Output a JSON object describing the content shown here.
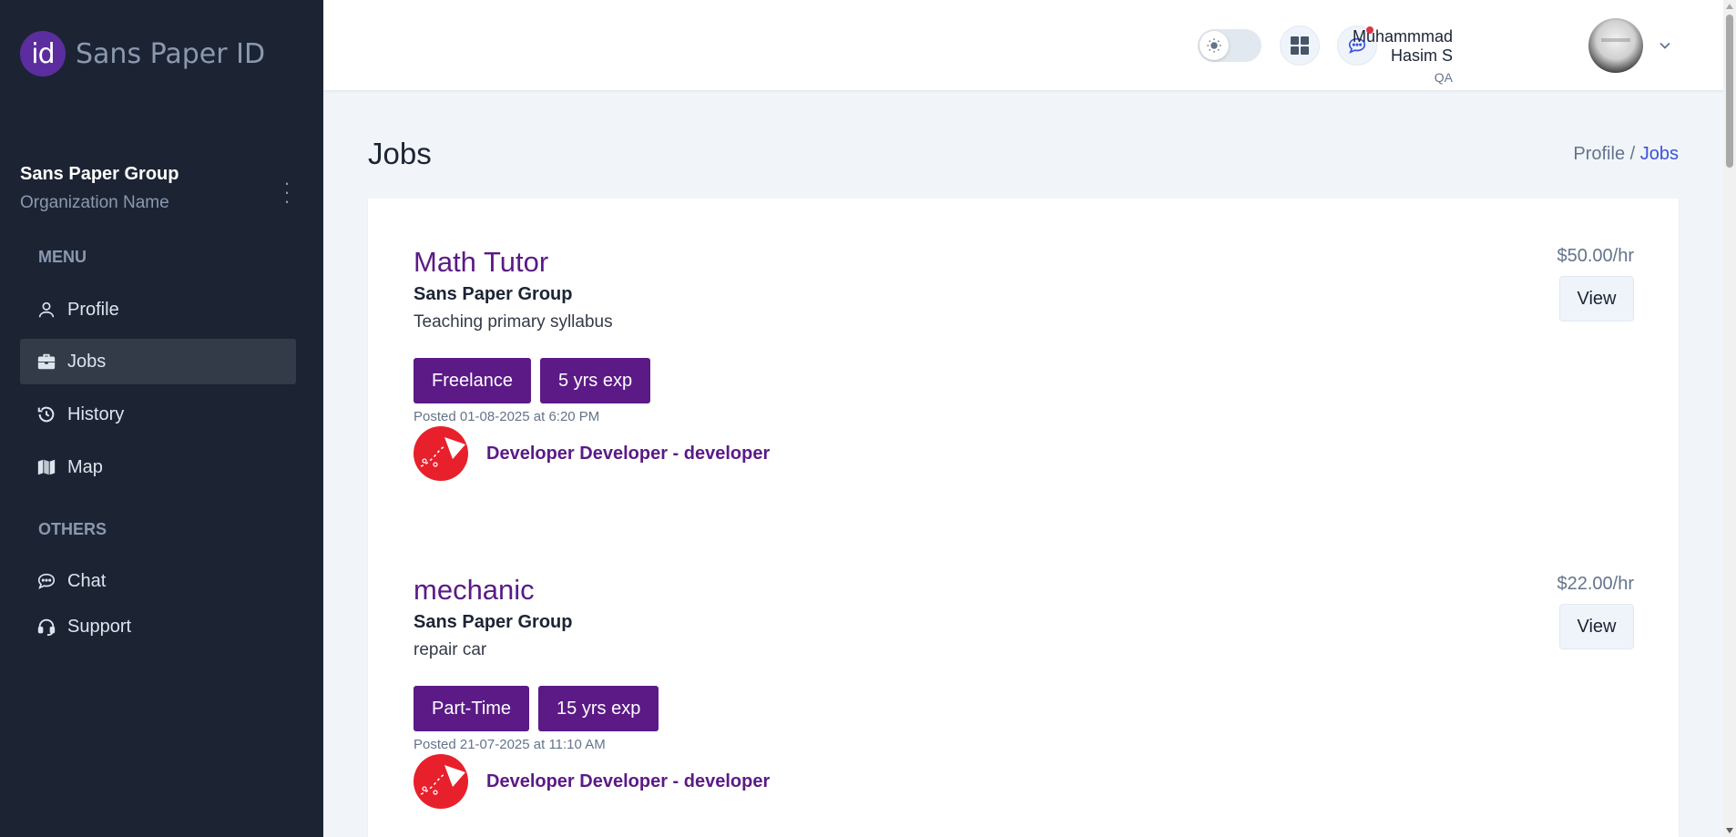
{
  "brand": {
    "logo_text": "id",
    "name": "Sans Paper ID"
  },
  "organization": {
    "name": "Sans Paper Group",
    "subtitle": "Organization Name"
  },
  "sidebar": {
    "menu_title": "MENU",
    "menu_items": [
      {
        "label": "Profile",
        "icon": "user-icon",
        "active": false
      },
      {
        "label": "Jobs",
        "icon": "briefcase-icon",
        "active": true
      },
      {
        "label": "History",
        "icon": "history-icon",
        "active": false
      },
      {
        "label": "Map",
        "icon": "map-icon",
        "active": false
      }
    ],
    "others_title": "OTHERS",
    "others_items": [
      {
        "label": "Chat",
        "icon": "chat-icon"
      },
      {
        "label": "Support",
        "icon": "headset-icon"
      }
    ]
  },
  "header": {
    "user_name": "Muhammmad Hasim S",
    "user_role": "QA",
    "has_notification": true
  },
  "page": {
    "title": "Jobs",
    "breadcrumb": {
      "parent": "Profile /",
      "current": "Jobs"
    }
  },
  "jobs": [
    {
      "title": "Math Tutor",
      "organization": "Sans Paper Group",
      "description": "Teaching primary syllabus",
      "tags": [
        "Freelance",
        "5 yrs exp"
      ],
      "posted": "Posted 01-08-2025 at 6:20 PM",
      "poster": "Developer Developer - developer",
      "rate": "$50.00/hr",
      "view_label": "View"
    },
    {
      "title": "mechanic",
      "organization": "Sans Paper Group",
      "description": "repair car",
      "tags": [
        "Part-Time",
        "15 yrs exp"
      ],
      "posted": "Posted 21-07-2025 at 11:10 AM",
      "poster": "Developer Developer - developer",
      "rate": "$22.00/hr",
      "view_label": "View"
    }
  ],
  "colors": {
    "sidebar_bg": "#1c2434",
    "accent_purple": "#5b1a86",
    "breadcrumb_active": "#3c50e0",
    "notification_dot": "#dc3545",
    "poster_logo_red": "#e8202c"
  }
}
